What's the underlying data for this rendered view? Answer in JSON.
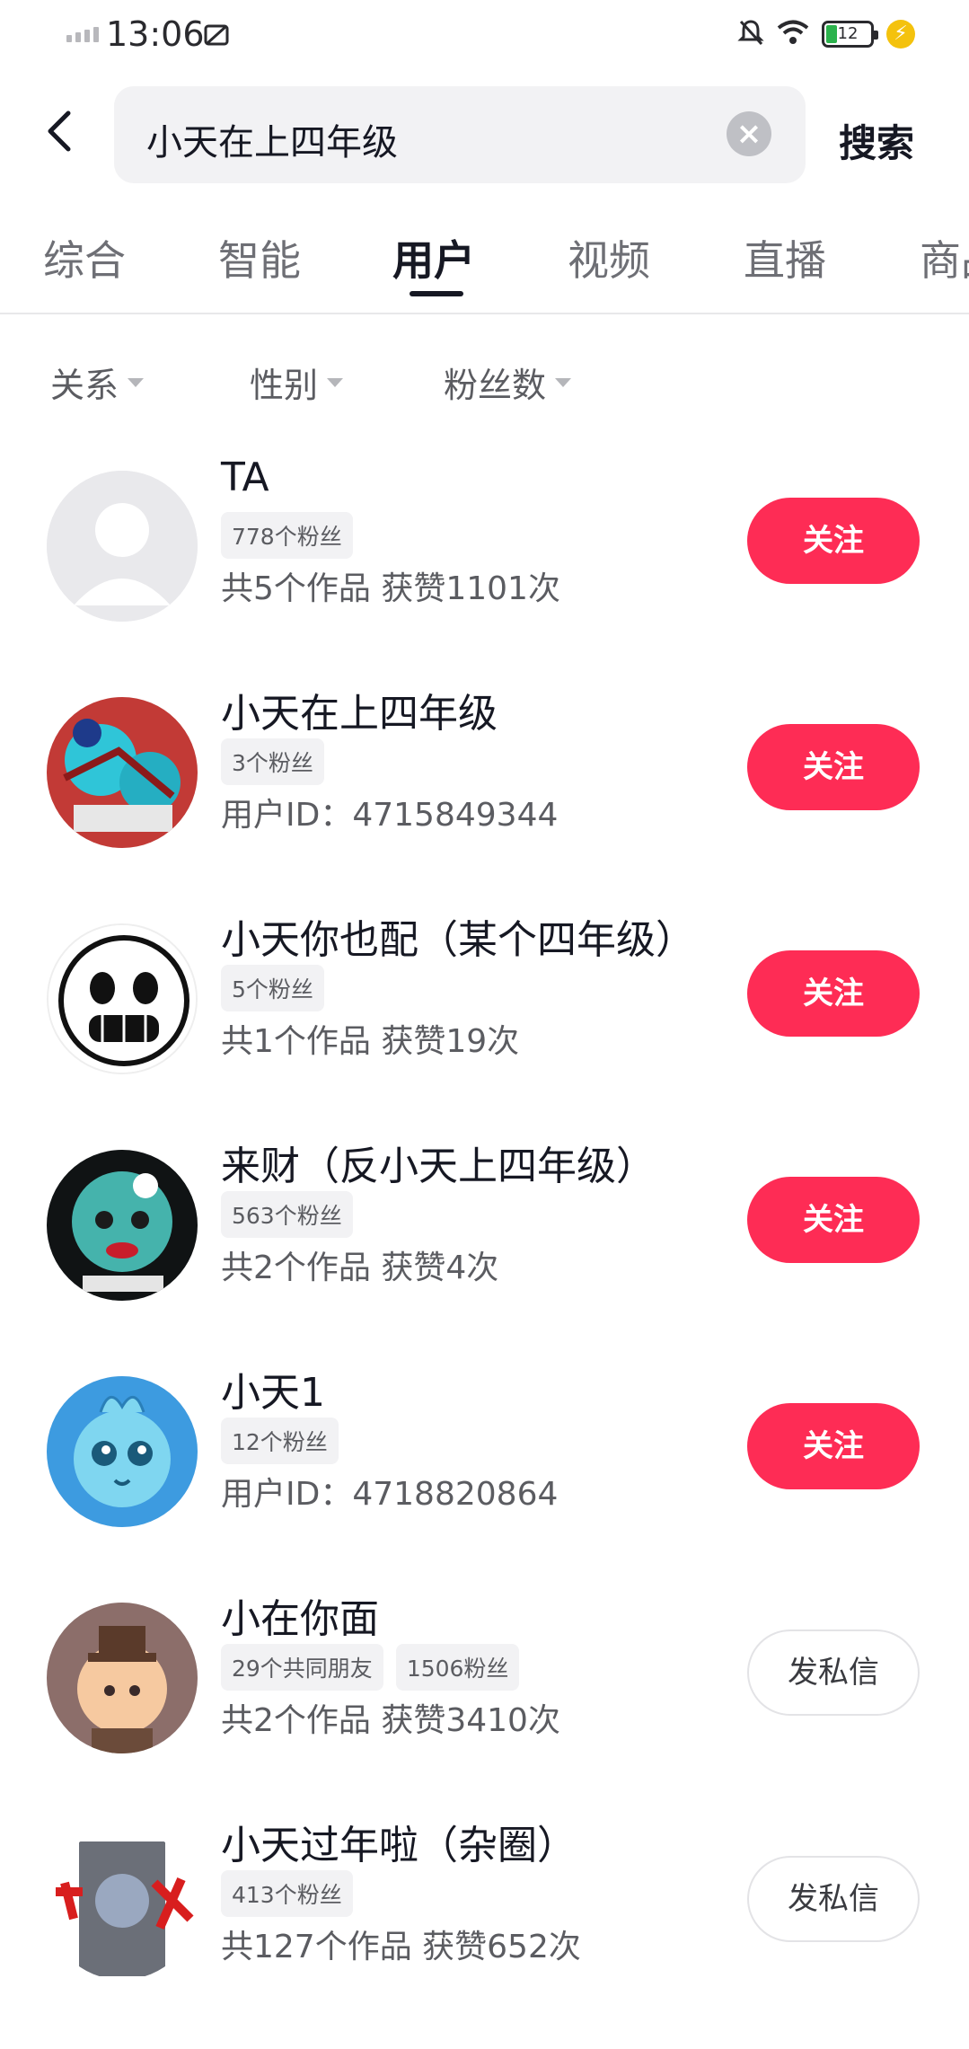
{
  "status_bar": {
    "time": "13:06",
    "battery": "12",
    "icons": [
      "signal-icon",
      "hd-icon",
      "mute-icon",
      "wifi-icon",
      "battery-icon",
      "charging-icon"
    ]
  },
  "search": {
    "query": "小天在上四年级",
    "button_label": "搜索"
  },
  "tabs": [
    {
      "label": "综合"
    },
    {
      "label": "智能"
    },
    {
      "label": "用户"
    },
    {
      "label": "视频"
    },
    {
      "label": "直播"
    },
    {
      "label": "商品"
    }
  ],
  "active_tab": "用户",
  "filters": [
    {
      "label": "关系"
    },
    {
      "label": "性别"
    },
    {
      "label": "粉丝数"
    }
  ],
  "users": [
    {
      "name": "TA",
      "badges": [
        "778个粉丝"
      ],
      "meta": "共5个作品 获赞1101次",
      "action": "关注",
      "action_type": "follow"
    },
    {
      "name": "小天在上四年级",
      "badges": [
        "3个粉丝"
      ],
      "meta": "用户ID：4715849344",
      "action": "关注",
      "action_type": "follow"
    },
    {
      "name": "小天你也配（某个四年级）",
      "badges": [
        "5个粉丝"
      ],
      "meta": "共1个作品 获赞19次",
      "action": "关注",
      "action_type": "follow"
    },
    {
      "name": "来财（反小天上四年级）",
      "badges": [
        "563个粉丝"
      ],
      "meta": "共2个作品 获赞4次",
      "action": "关注",
      "action_type": "follow"
    },
    {
      "name": "小天1",
      "badges": [
        "12个粉丝"
      ],
      "meta": "用户ID：4718820864",
      "action": "关注",
      "action_type": "follow"
    },
    {
      "name": "小在你面",
      "badges": [
        "29个共同朋友",
        "1506粉丝"
      ],
      "meta": "共2个作品 获赞3410次",
      "action": "发私信",
      "action_type": "message"
    },
    {
      "name": "小天过年啦（杂圈）",
      "badges": [
        "413个粉丝"
      ],
      "meta": "共127个作品 获赞652次",
      "action": "发私信",
      "action_type": "message"
    }
  ],
  "colors": {
    "accent": "#fe2c55",
    "text_primary": "#161823",
    "text_secondary": "#5b5c61",
    "badge_bg": "#f2f2f4"
  }
}
